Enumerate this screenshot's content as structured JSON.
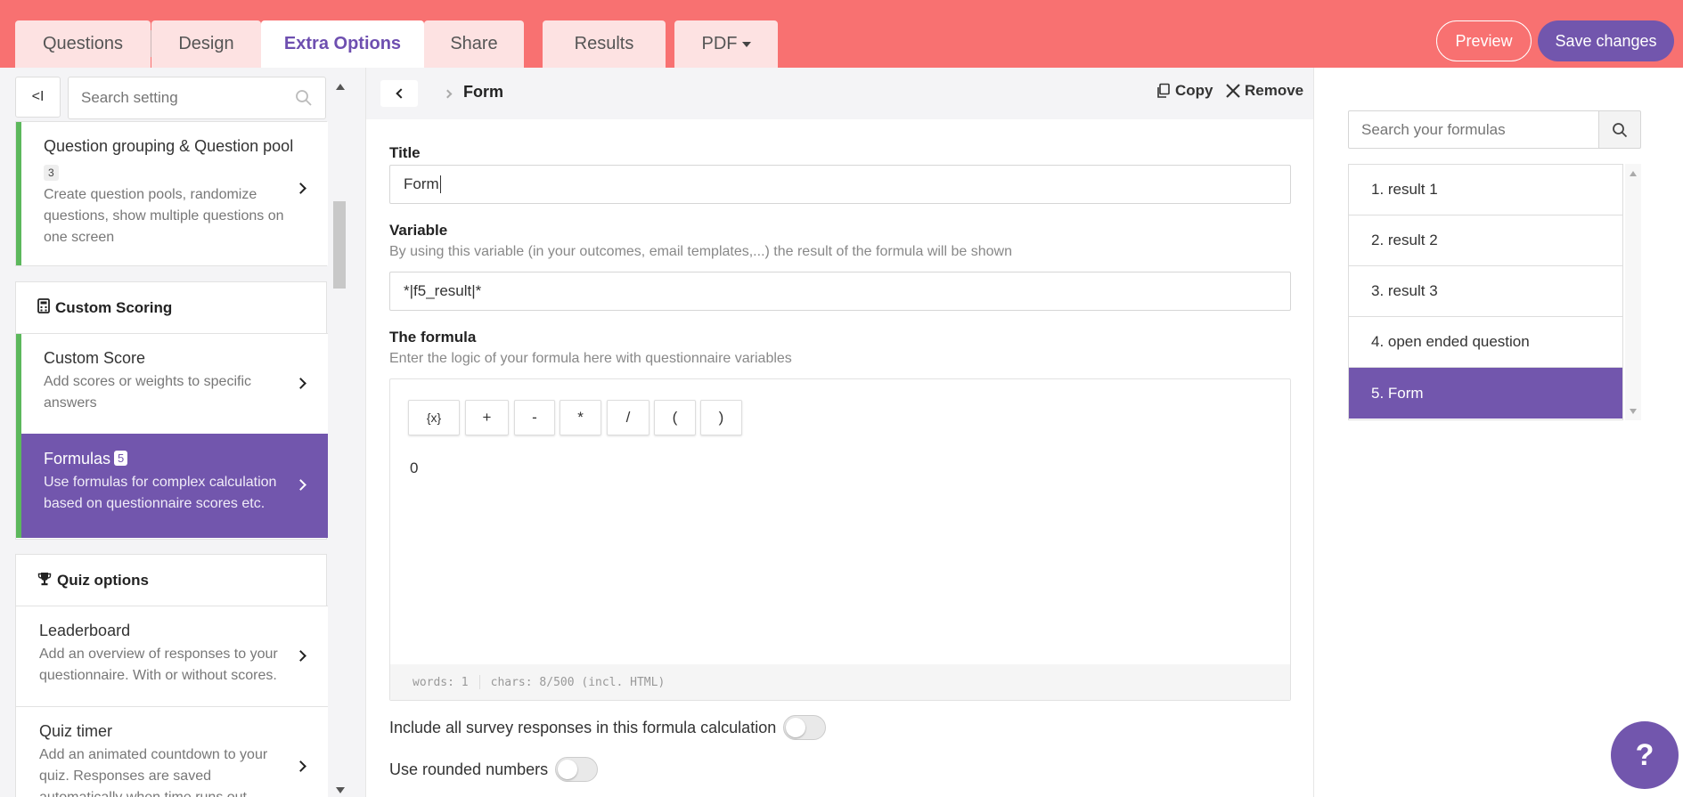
{
  "tabs": [
    {
      "label": "Questions"
    },
    {
      "label": "Design"
    },
    {
      "label": "Extra Options"
    },
    {
      "label": "Share"
    },
    {
      "label": "Results"
    },
    {
      "label": "PDF"
    }
  ],
  "header_actions": {
    "preview": "Preview",
    "save": "Save changes"
  },
  "sidebar": {
    "collapse_label": "<I",
    "search_placeholder": "Search setting",
    "group_item": {
      "title": "Question grouping & Question pool",
      "badge": "3",
      "desc": "Create question pools, randomize questions, show multiple questions on one screen"
    },
    "custom_scoring": {
      "heading": "Custom Scoring",
      "icon": "calculator-icon",
      "items": [
        {
          "title": "Custom Score",
          "desc": "Add scores or weights to specific answers"
        },
        {
          "title": "Formulas",
          "badge": "5",
          "desc": "Use formulas for complex calculation based on questionnaire scores etc."
        }
      ]
    },
    "quiz_options": {
      "heading": "Quiz options",
      "icon": "trophy-icon",
      "items": [
        {
          "title": "Leaderboard",
          "desc": "Add an overview of responses to your questionnaire. With or without scores."
        },
        {
          "title": "Quiz timer",
          "desc": "Add an animated countdown to your quiz. Responses are saved automatically when time runs out"
        }
      ]
    }
  },
  "main": {
    "breadcrumb": "Form",
    "copy_label": "Copy",
    "remove_label": "Remove",
    "title_label": "Title",
    "title_value": "Form",
    "variable_label": "Variable",
    "variable_help": "By using this variable (in your outcomes, email templates,...) the result of the formula will be shown",
    "variable_value": "*|f5_result|*",
    "formula_label": "The formula",
    "formula_help": "Enter the logic of your formula here with questionnaire variables",
    "tools": [
      "{x}",
      "+",
      "-",
      "*",
      "/",
      "(",
      ")"
    ],
    "formula_content": "0",
    "status_words": "words: 1",
    "status_chars": "chars: 8/500 (incl. HTML)",
    "toggle_all_responses": "Include all survey responses in this formula calculation",
    "toggle_rounded": "Use rounded numbers"
  },
  "formulas": {
    "search_placeholder": "Search your formulas",
    "items": [
      "1. result 1",
      "2. result 2",
      "3. result 3",
      "4. open ended question",
      "5. Form"
    ]
  },
  "help_fab": "?",
  "colors": {
    "brand_purple": "#7256ad",
    "topbar": "#f87171",
    "green_accent": "#5cb85c"
  }
}
